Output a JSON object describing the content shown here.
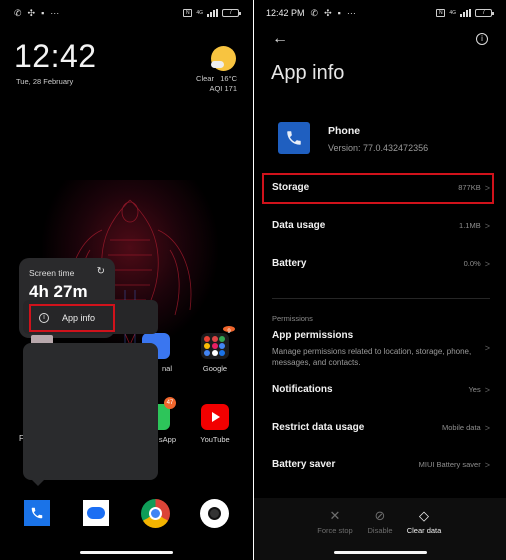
{
  "left_screen": {
    "status_bar": {
      "icons": [
        "whatsapp-icon",
        "fan-icon",
        "lock-icon",
        "more-icon"
      ],
      "more": "···",
      "sim": "N",
      "network": "4G",
      "battery": "7"
    },
    "clock": {
      "time": "12:42",
      "date": "Tue, 28 February"
    },
    "weather": {
      "condition": "Clear",
      "temperature": "16°C",
      "aqi": "AQI 171"
    },
    "widget_popup": {
      "screen_time_label": "Screen time",
      "screen_time_value": "4h 27m",
      "menu_item": "App info"
    },
    "apps": [
      {
        "name": "nal",
        "partial": true
      },
      {
        "name": "Google",
        "badge": "9"
      },
      {
        "name": "sApp",
        "badge": "47",
        "partial": true
      },
      {
        "name": "YouTube"
      },
      {
        "name": "F",
        "partial": true
      }
    ],
    "dock": [
      "Phone",
      "Messages",
      "Chrome",
      "Camera"
    ]
  },
  "right_screen": {
    "status_bar": {
      "time": "12:42 PM",
      "more": "···",
      "sim": "N",
      "network": "4G",
      "battery": "7"
    },
    "header": {
      "title": "App info"
    },
    "app": {
      "name": "Phone",
      "version": "Version: 77.0.432472356"
    },
    "rows": [
      {
        "label": "Storage",
        "value": "877KB"
      },
      {
        "label": "Data usage",
        "value": "1.1MB"
      },
      {
        "label": "Battery",
        "value": "0.0%"
      }
    ],
    "permissions": {
      "section_label": "Permissions",
      "title": "App permissions",
      "description": "Manage permissions related to location, storage, phone, messages, and contacts."
    },
    "rows2": [
      {
        "label": "Notifications",
        "value": "Yes"
      },
      {
        "label": "Restrict data usage",
        "value": "Mobile data"
      },
      {
        "label": "Battery saver",
        "value": "MIUI Battery saver"
      }
    ],
    "actions": [
      {
        "label": "Force stop",
        "icon": "✕",
        "enabled": false
      },
      {
        "label": "Disable",
        "icon": "⊘",
        "enabled": false
      },
      {
        "label": "Clear data",
        "icon": "◇",
        "enabled": true
      }
    ],
    "highlight_color": "#d0121b"
  }
}
